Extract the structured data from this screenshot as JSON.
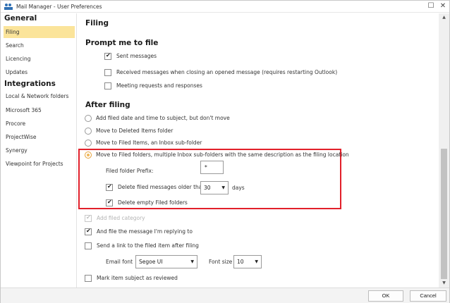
{
  "window": {
    "title": "Mail Manager - User Preferences",
    "controls": {
      "maximize": "☐",
      "close": "✕"
    }
  },
  "sidebar": {
    "groups": [
      {
        "title": "General",
        "items": [
          "Filing",
          "Search",
          "Licencing",
          "Updates"
        ]
      },
      {
        "title": "Integrations",
        "items": [
          "Local & Network folders",
          "Microsoft 365",
          "Procore",
          "ProjectWise",
          "Synergy",
          "Viewpoint for Projects"
        ]
      }
    ],
    "active_item": "Filing"
  },
  "content": {
    "page_title": "Filing",
    "prompt_section": {
      "title": "Prompt me to file",
      "options": [
        {
          "label": "Sent messages",
          "checked": true
        },
        {
          "label": "Received messages when closing an opened message (requires restarting Outlook)",
          "checked": false
        },
        {
          "label": "Meeting requests and responses",
          "checked": false
        }
      ]
    },
    "after_section": {
      "title": "After filing",
      "radios": [
        {
          "label": "Add filed date and time to subject, but don't move",
          "selected": false
        },
        {
          "label": "Move to Deleted Items folder",
          "selected": false
        },
        {
          "label": "Move to Filed Items, an Inbox sub-folder",
          "selected": false
        },
        {
          "label": "Move to Filed folders, multiple Inbox sub-folders with the same description as the filing location",
          "selected": true
        }
      ],
      "prefix_label": "Filed folder Prefix:",
      "prefix_value": "*",
      "delete_older_label": "Delete filed messages older than:",
      "delete_older_checked": true,
      "days_value": "30",
      "days_label": "days",
      "delete_empty_label": "Delete empty Filed folders",
      "delete_empty_checked": true,
      "add_category_label": "Add filed category",
      "reply_label": "And file the message I'm replying to",
      "send_link_label": "Send a link to the filed item after filing",
      "email_font_label": "Email font",
      "email_font_value": "Segoe UI",
      "font_size_label": "Font size",
      "font_size_value": "10",
      "mark_reviewed_label": "Mark item subject as reviewed"
    },
    "highlight_color": "#e2202b"
  },
  "footer": {
    "ok_label": "OK",
    "cancel_label": "Cancel"
  },
  "colors": {
    "active_item_bg": "#fbe49a",
    "selected_radio": "#f0b75a"
  }
}
